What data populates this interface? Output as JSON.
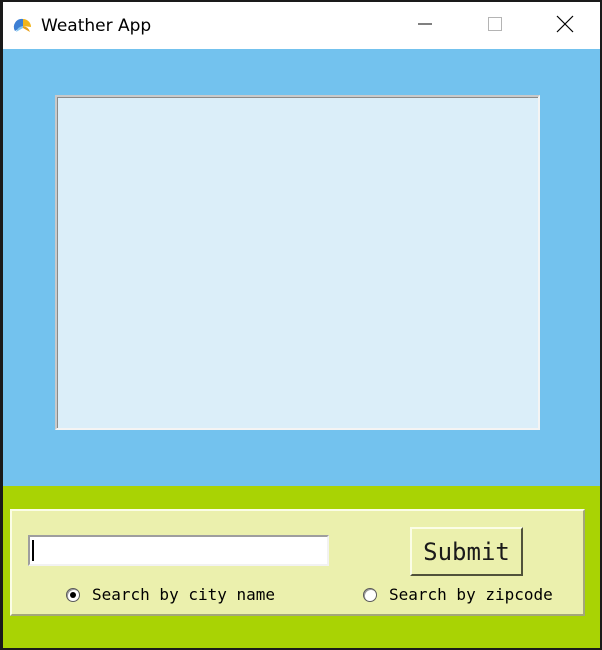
{
  "window": {
    "title": "Weather App",
    "app_icon": "weather-app-icon",
    "controls": {
      "minimize_icon": "minimize-icon",
      "maximize_icon": "maximize-icon",
      "close_icon": "close-icon"
    }
  },
  "display": {
    "content": ""
  },
  "search": {
    "entry_value": "",
    "submit_label": "Submit",
    "options": [
      {
        "label": "Search by city name",
        "selected": true
      },
      {
        "label": "Search by zipcode",
        "selected": false
      }
    ]
  },
  "colors": {
    "top_panel": "#73c2ee",
    "display_box": "#dbeef9",
    "bottom_panel": "#a9d304",
    "control_frame": "#ebf0ad"
  }
}
